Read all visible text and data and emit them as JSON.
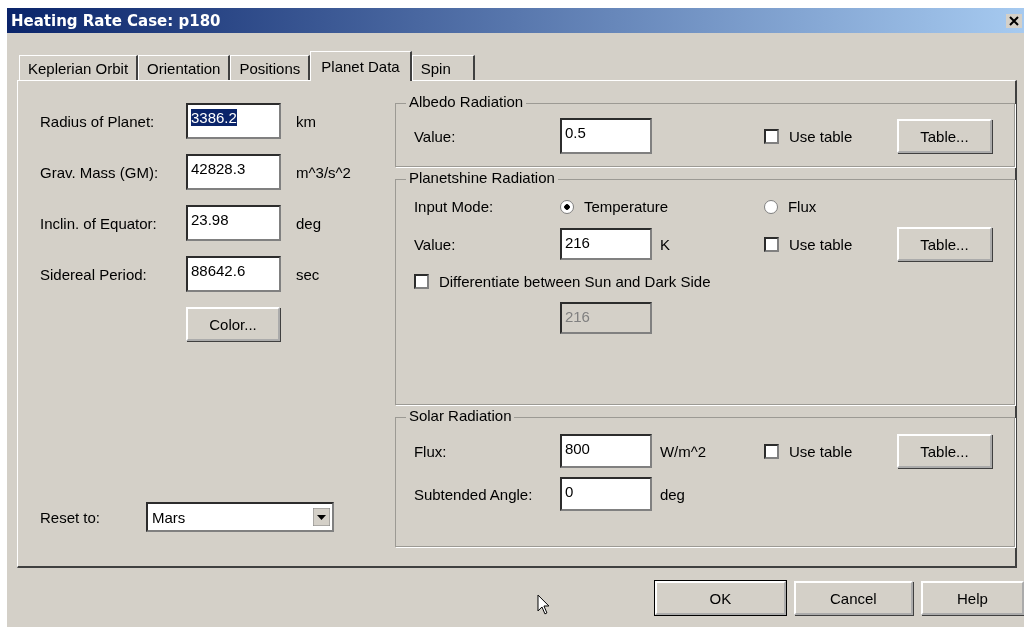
{
  "window": {
    "title": "Heating Rate Case: p180"
  },
  "tabs": [
    {
      "label": "Keplerian Orbit",
      "selected": false
    },
    {
      "label": "Orientation",
      "selected": false
    },
    {
      "label": "Positions",
      "selected": false
    },
    {
      "label": "Planet Data",
      "selected": true
    },
    {
      "label": "Spin",
      "selected": false
    }
  ],
  "planet_fields": [
    {
      "label": "Radius of Planet:",
      "value": "3386.2",
      "unit": "km",
      "text_selected": true
    },
    {
      "label": "Grav. Mass (GM):",
      "value": "42828.3",
      "unit": "m^3/s^2",
      "text_selected": false
    },
    {
      "label": "Inclin. of Equator:",
      "value": "23.98",
      "unit": "deg",
      "text_selected": false
    },
    {
      "label": "Sidereal Period:",
      "value": "88642.6",
      "unit": "sec",
      "text_selected": false
    }
  ],
  "color_button": "Color...",
  "reset": {
    "label": "Reset to:",
    "value": "Mars"
  },
  "albedo": {
    "title": "Albedo Radiation",
    "value_label": "Value:",
    "value": "0.5",
    "use_table": {
      "label": "Use table",
      "checked": false
    },
    "table_button": "Table..."
  },
  "planetshine": {
    "title": "Planetshine Radiation",
    "input_mode_label": "Input Mode:",
    "modes": [
      {
        "label": "Temperature",
        "selected": true
      },
      {
        "label": "Flux",
        "selected": false
      }
    ],
    "value_label": "Value:",
    "value": "216",
    "unit": "K",
    "use_table": {
      "label": "Use table",
      "checked": false
    },
    "table_button": "Table...",
    "differentiate": {
      "label": "Differentiate between Sun and Dark Side",
      "checked": false
    },
    "dark_side_value": {
      "value": "216",
      "disabled": true
    }
  },
  "solar": {
    "title": "Solar Radiation",
    "flux_label": "Flux:",
    "flux": "800",
    "flux_unit": "W/m^2",
    "use_table": {
      "label": "Use table",
      "checked": false
    },
    "table_button": "Table...",
    "angle_label": "Subtended Angle:",
    "angle": "0",
    "angle_unit": "deg"
  },
  "buttons": [
    {
      "label": "OK",
      "default": true
    },
    {
      "label": "Cancel",
      "default": false
    },
    {
      "label": "Help",
      "default": false
    }
  ]
}
